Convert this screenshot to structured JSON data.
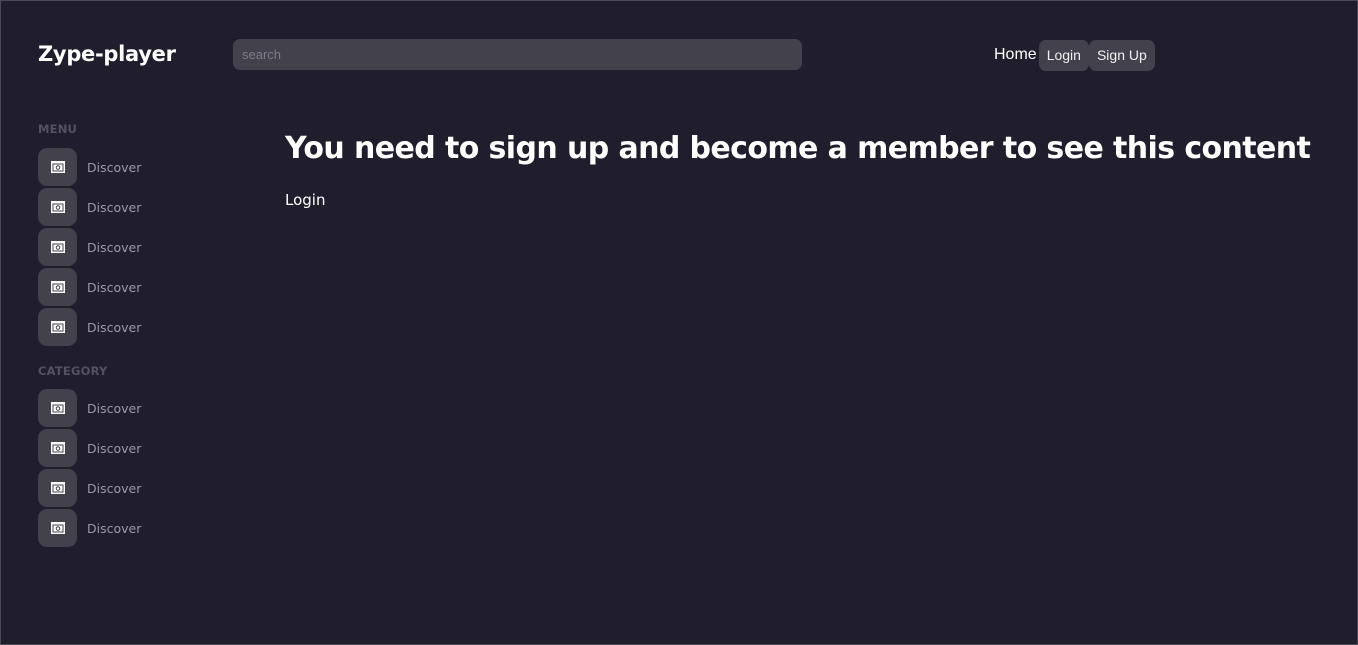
{
  "header": {
    "app_title": "Zype-player",
    "search_placeholder": "search",
    "nav": {
      "home": "Home",
      "login": "Login",
      "signup": "Sign Up"
    }
  },
  "sidebar": {
    "menu_title": "MENU",
    "menu_items": [
      {
        "label": "Discover",
        "icon": "calendar-icon"
      },
      {
        "label": "Discover",
        "icon": "calendar-icon"
      },
      {
        "label": "Discover",
        "icon": "calendar-icon"
      },
      {
        "label": "Discover",
        "icon": "calendar-icon"
      },
      {
        "label": "Discover",
        "icon": "calendar-icon"
      }
    ],
    "category_title": "CATEGORY",
    "category_items": [
      {
        "label": "Discover",
        "icon": "calendar-icon"
      },
      {
        "label": "Discover",
        "icon": "calendar-icon"
      },
      {
        "label": "Discover",
        "icon": "calendar-icon"
      },
      {
        "label": "Discover",
        "icon": "calendar-icon"
      }
    ]
  },
  "main": {
    "heading": "You need to sign up and become a member to see this content",
    "login_link": "Login"
  },
  "colors": {
    "background": "#201e2c",
    "surface": "#43414c",
    "muted_text": "#9b99a6",
    "section_title": "#54525e"
  }
}
